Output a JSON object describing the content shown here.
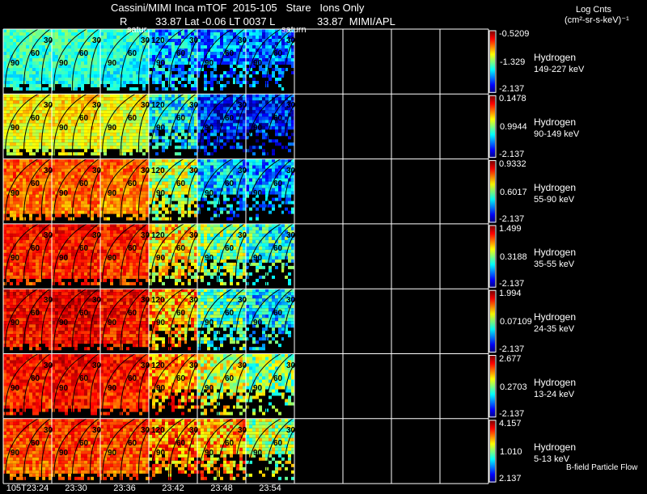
{
  "header": {
    "line1": "Cassini/MIMI Inca mTOF  2015-105   Stare   Ions Only",
    "line2_r": "R",
    "line2_rest": "33.87 Lat -0.06 LT 0037 L",
    "line2_l": "33.87  MIMI/APL",
    "saturn_label_a": "satur",
    "saturn_label_b": "saturn"
  },
  "units": {
    "line1": "Log Cnts",
    "line2": "(cm²-sr-s-keV)⁻¹"
  },
  "footer_note": "B-field Particle Flow",
  "chart_data": {
    "type": "heatmap",
    "time_labels": [
      "105T23:24",
      "23:30",
      "23:36",
      "23:42",
      "23:48",
      "23:54"
    ],
    "empty_columns": 4,
    "contour_labels": [
      "120",
      "90",
      "60",
      "30"
    ],
    "colormap": "jet",
    "rows": [
      {
        "species": "Hydrogen",
        "energy": "149-227 keV",
        "max": "-0.5209",
        "mid": "-1.329",
        "min": "-2.137"
      },
      {
        "species": "Hydrogen",
        "energy": "90-149 keV",
        "max": "0.1478",
        "mid": "0.9944",
        "min": "-2.137"
      },
      {
        "species": "Hydrogen",
        "energy": "55-90 keV",
        "max": "0.9332",
        "mid": "0.6017",
        "min": "-2.137"
      },
      {
        "species": "Hydrogen",
        "energy": "35-55 keV",
        "max": "1.499",
        "mid": "0.3188",
        "min": "-2.137"
      },
      {
        "species": "Hydrogen",
        "energy": "24-35 keV",
        "max": "1.994",
        "mid": "0.07109",
        "min": "-2.137"
      },
      {
        "species": "Hydrogen",
        "energy": "13-24 keV",
        "max": "2.677",
        "mid": "0.2703",
        "min": "-2.137"
      },
      {
        "species": "Hydrogen",
        "energy": "5-13 keV",
        "max": "4.157",
        "mid": "1.010",
        "min": "2.137"
      }
    ]
  }
}
